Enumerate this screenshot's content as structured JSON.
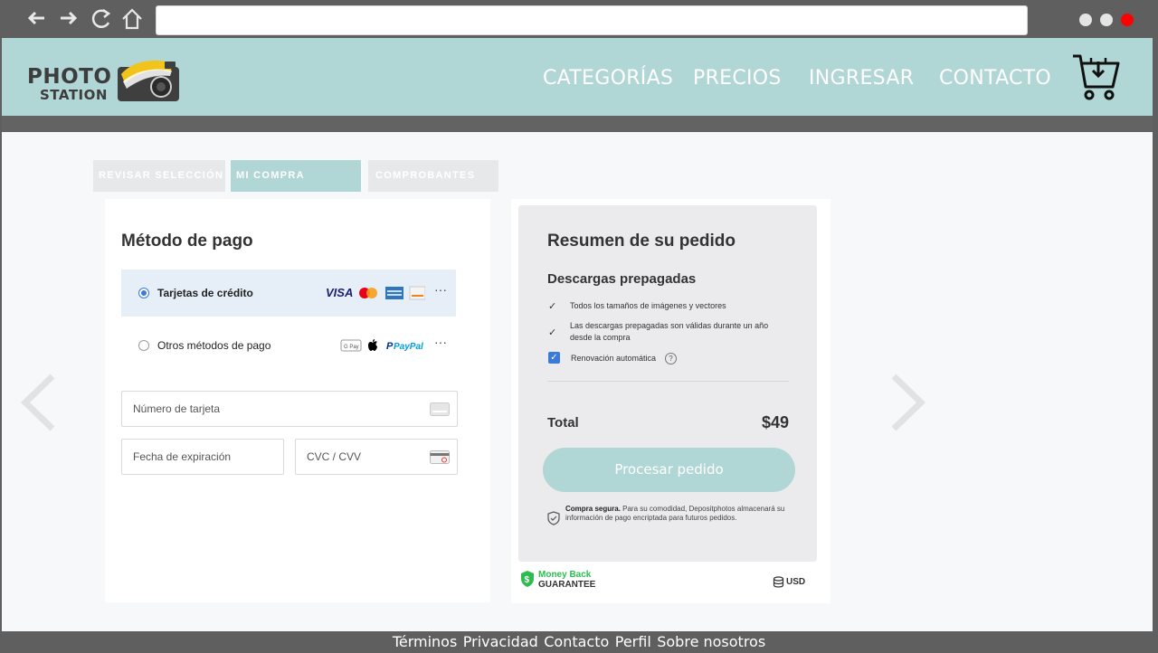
{
  "browser": {
    "back_icon": "back-arrow-icon",
    "forward_icon": "forward-arrow-icon",
    "reload_icon": "reload-icon",
    "home_icon": "home-icon",
    "address": "",
    "window_dots_colors": [
      "#e4e4e4",
      "#e4e4e4",
      "#ff0000"
    ]
  },
  "header": {
    "logo_line1": "PHOTO",
    "logo_line2": "STATION",
    "nav": [
      "CATEGORÍAS",
      "PRECIOS",
      "INGRESAR",
      "CONTACTO"
    ],
    "cart_icon": "cart-download-icon",
    "bg_color": "#b1d6d6"
  },
  "steps": [
    {
      "label": "REVISAR SELECCIÓN",
      "state": "done"
    },
    {
      "label": "MI COMPRA",
      "state": "active"
    },
    {
      "label": "COMPROBANTES",
      "state": "pending"
    }
  ],
  "payment": {
    "title": "Método de pago",
    "option_card": "Tarjetas de crédito",
    "option_other": "Otros métodos de pago",
    "card_brands": [
      "VISA",
      "mastercard",
      "amex",
      "discover"
    ],
    "other_brands": [
      "G Pay",
      "apple",
      "PayPal"
    ],
    "more": "···",
    "selected": "Tarjetas de crédito",
    "card_number_placeholder": "Número de tarjeta",
    "expiry_placeholder": "Fecha de expiración",
    "cvc_placeholder": "CVC / CVV"
  },
  "summary": {
    "title": "Resumen de su pedido",
    "subtitle": "Descargas prepagadas",
    "features": [
      "Todos los tamaños de imágenes y vectores",
      "Las descargas prepagadas son válidas durante un año",
      "desde la compra"
    ],
    "auto_renew": "Renovación automática",
    "auto_renew_checked": true,
    "help": "?",
    "total_label": "Total",
    "total_value": "$49",
    "cta": "Procesar pedido",
    "secure_bold": "Compra segura.",
    "secure_text": " Para su comodidad, Depositphotos almacenará su información de pago encriptada para futuros pedidos.",
    "money_back_top": "Money Back",
    "money_back_bottom": "GUARANTEE",
    "currency": "USD"
  },
  "footer": {
    "links": [
      "Términos",
      "Privacidad",
      "Contacto",
      "Perfil",
      "Sobre nosotros"
    ]
  }
}
